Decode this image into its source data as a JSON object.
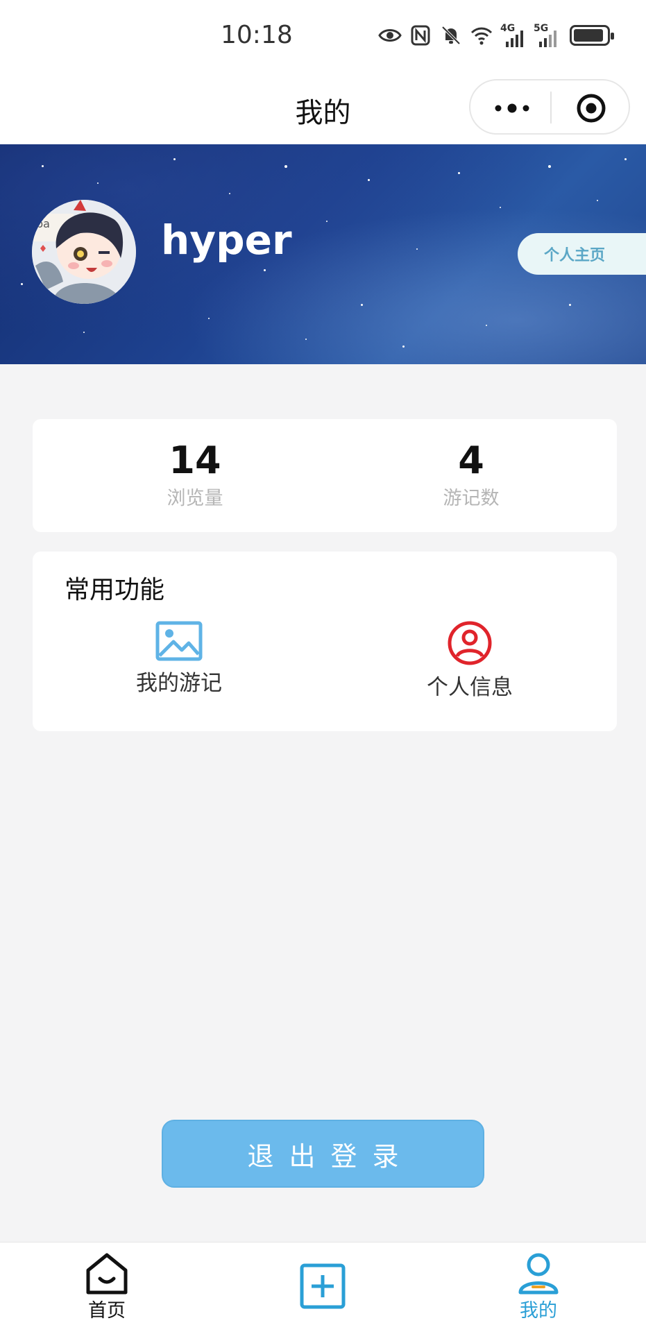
{
  "status_bar": {
    "time": "10:18",
    "network_1": "4G",
    "network_2": "5G"
  },
  "nav": {
    "title": "我的",
    "more_icon": "more-dots-icon",
    "target_icon": "target-icon"
  },
  "profile": {
    "username": "hyper",
    "home_button": "个人主页"
  },
  "stats": [
    {
      "value": "14",
      "label": "浏览量"
    },
    {
      "value": "4",
      "label": "游记数"
    }
  ],
  "functions": {
    "title": "常用功能",
    "items": [
      {
        "label": "我的游记",
        "icon": "image-icon",
        "color": "#5fb3e6"
      },
      {
        "label": "个人信息",
        "icon": "user-circle-icon",
        "color": "#e0242b"
      }
    ]
  },
  "logout": {
    "label": "退出登录"
  },
  "tab_bar": {
    "items": [
      {
        "label": "首页",
        "icon": "home-icon",
        "active": false
      },
      {
        "label": "",
        "icon": "add-square-icon",
        "active": false
      },
      {
        "label": "我的",
        "icon": "user-icon",
        "active": true
      }
    ],
    "active_color": "#2a9fd6",
    "inactive_color": "#111111"
  },
  "colors": {
    "accent": "#6bbaec",
    "banner": "#1e4290"
  }
}
